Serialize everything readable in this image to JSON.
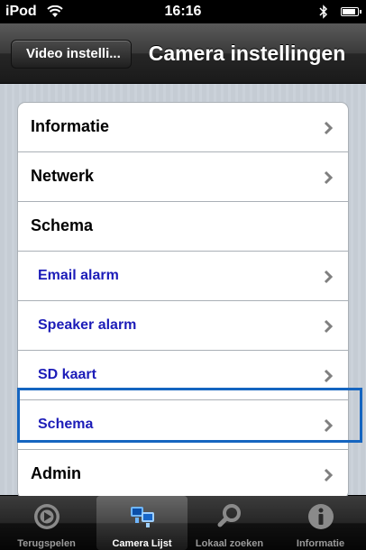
{
  "status": {
    "carrier": "iPod",
    "time": "16:16",
    "battery_level": 0.95
  },
  "nav": {
    "back_label": "Video instelli...",
    "title": "Camera instellingen"
  },
  "settings": {
    "items": [
      {
        "label": "Informatie",
        "chevron": true,
        "sub": false
      },
      {
        "label": "Netwerk",
        "chevron": true,
        "sub": false
      },
      {
        "label": "Schema",
        "chevron": false,
        "sub": false
      },
      {
        "label": "Email alarm",
        "chevron": true,
        "sub": true
      },
      {
        "label": "Speaker alarm",
        "chevron": true,
        "sub": true
      },
      {
        "label": "SD kaart",
        "chevron": true,
        "sub": true
      },
      {
        "label": "Schema",
        "chevron": true,
        "sub": true,
        "highlighted": true
      },
      {
        "label": "Admin",
        "chevron": true,
        "sub": false
      }
    ]
  },
  "tabs": [
    {
      "label": "Terugspelen",
      "icon": "playback-icon",
      "active": false
    },
    {
      "label": "Camera Lijst",
      "icon": "camera-list-icon",
      "active": true
    },
    {
      "label": "Lokaal zoeken",
      "icon": "search-icon",
      "active": false
    },
    {
      "label": "Informatie",
      "icon": "info-icon",
      "active": false
    }
  ],
  "colors": {
    "highlight": "#1565c0",
    "sublabel": "#1c1cb8"
  }
}
